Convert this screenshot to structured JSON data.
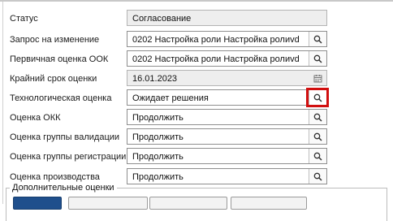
{
  "form": {
    "fields": [
      {
        "label": "Статус",
        "value": "Согласование",
        "readonly": true,
        "button": "none"
      },
      {
        "label": "Запрос на изменение",
        "value": "0202 Настройка роли Настройка ролиvd",
        "readonly": false,
        "button": "search-icon"
      },
      {
        "label": "Первичная оценка ООК",
        "value": "0202 Настройка роли Настройка ролиvd",
        "readonly": false,
        "button": "search-icon"
      },
      {
        "label": "Крайний срок оценки",
        "value": "16.01.2023",
        "readonly": true,
        "button": "calendar-icon"
      },
      {
        "label": "Технологическая оценка",
        "value": "Ожидает решения",
        "readonly": false,
        "button": "search-icon",
        "highlighted": true
      },
      {
        "label": "Оценка ОКК",
        "value": "Продолжить",
        "readonly": false,
        "button": "search-icon"
      },
      {
        "label": "Оценка группы валидации",
        "value": "Продолжить",
        "readonly": false,
        "button": "search-icon"
      },
      {
        "label": "Оценка группы регистрации",
        "value": "Продолжить",
        "readonly": false,
        "button": "search-icon"
      },
      {
        "label": "Оценка производства",
        "value": "Продолжить",
        "readonly": false,
        "button": "search-icon"
      }
    ]
  },
  "additional_section": {
    "legend": "Дополнительные оценки"
  },
  "colors": {
    "highlight": "#d10f0f",
    "primary_button": "#1f4f8c"
  }
}
